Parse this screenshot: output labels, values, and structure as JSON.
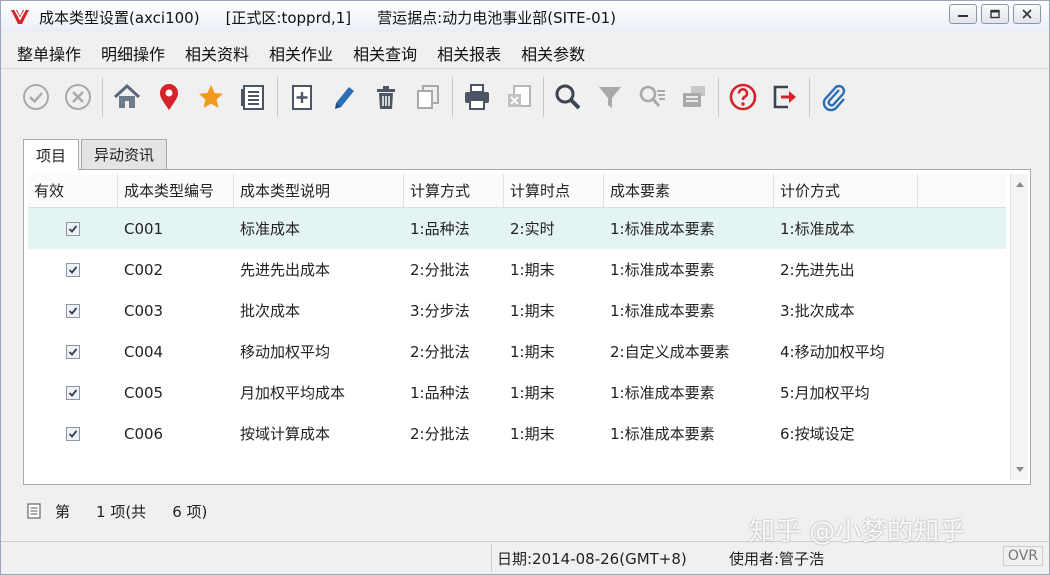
{
  "titlebar": {
    "title": "成本类型设置(axci100)",
    "env": "[正式区:topprd,1]",
    "site": "营运据点:动力电池事业部(SITE-01)"
  },
  "menu": [
    "整单操作",
    "明细操作",
    "相关资料",
    "相关作业",
    "相关查询",
    "相关报表",
    "相关参数"
  ],
  "tabs": [
    "项目",
    "异动资讯"
  ],
  "table": {
    "headers": [
      "有效",
      "成本类型编号",
      "成本类型说明",
      "计算方式",
      "计算时点",
      "成本要素",
      "计价方式"
    ],
    "rows": [
      {
        "code": "C001",
        "desc": "标准成本",
        "calc": "1:品种法",
        "point": "2:实时",
        "element": "1:标准成本要素",
        "pricing": "1:标准成本"
      },
      {
        "code": "C002",
        "desc": "先进先出成本",
        "calc": "2:分批法",
        "point": "1:期末",
        "element": "1:标准成本要素",
        "pricing": "2:先进先出"
      },
      {
        "code": "C003",
        "desc": "批次成本",
        "calc": "3:分步法",
        "point": "1:期末",
        "element": "1:标准成本要素",
        "pricing": "3:批次成本"
      },
      {
        "code": "C004",
        "desc": "移动加权平均",
        "calc": "2:分批法",
        "point": "1:期末",
        "element": "2:自定义成本要素",
        "pricing": "4:移动加权平均"
      },
      {
        "code": "C005",
        "desc": "月加权平均成本",
        "calc": "1:品种法",
        "point": "1:期末",
        "element": "1:标准成本要素",
        "pricing": "5:月加权平均"
      },
      {
        "code": "C006",
        "desc": "按域计算成本",
        "calc": "2:分批法",
        "point": "1:期末",
        "element": "1:标准成本要素",
        "pricing": "6:按域设定"
      }
    ]
  },
  "pager": {
    "label_page": "第",
    "current": "1 项(共",
    "total": "6 项)"
  },
  "status": {
    "date": "日期:2014-08-26(GMT+8)",
    "user": "使用者:管子浩",
    "mode": "OVR"
  },
  "watermark": "知乎 @小梦的知乎",
  "colors": {
    "selected_row": "#e4f4f2",
    "accent_red": "#d4232a",
    "icon_blue": "#2d6db5"
  }
}
